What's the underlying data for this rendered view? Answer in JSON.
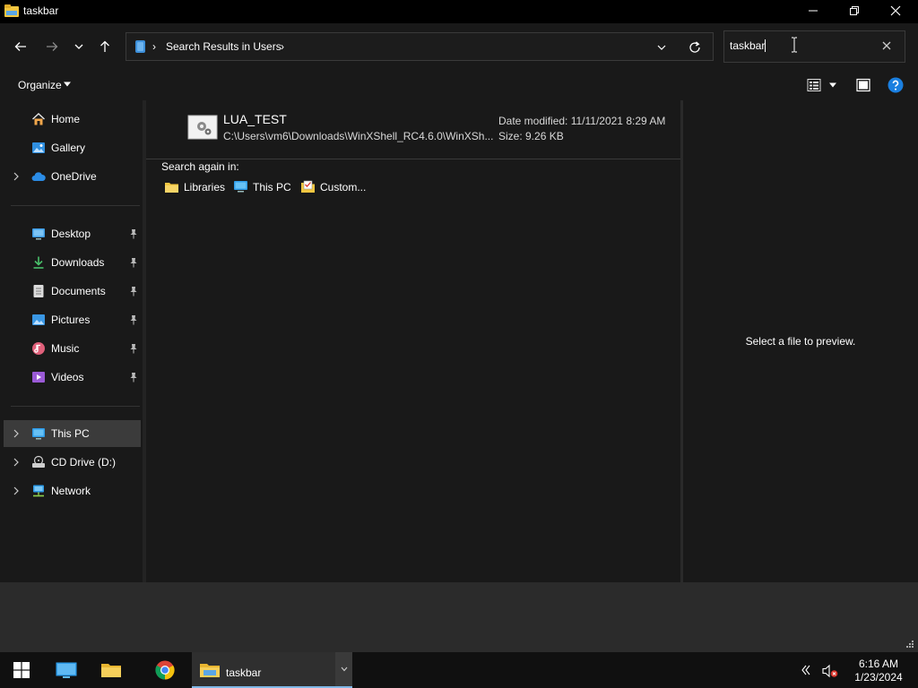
{
  "window": {
    "title": "taskbar"
  },
  "address": {
    "separator": "›",
    "path": "Search Results in Users",
    "trailing_separator": "›"
  },
  "search": {
    "value": "taskbar"
  },
  "commandbar": {
    "organize_label": "Organize"
  },
  "nav": {
    "quick": [
      {
        "label": "Home",
        "icon": "home-icon"
      },
      {
        "label": "Gallery",
        "icon": "gallery-icon"
      },
      {
        "label": "OneDrive",
        "icon": "onedrive-icon"
      }
    ],
    "pinned": [
      {
        "label": "Desktop",
        "icon": "desktop-icon"
      },
      {
        "label": "Downloads",
        "icon": "downloads-icon"
      },
      {
        "label": "Documents",
        "icon": "documents-icon"
      },
      {
        "label": "Pictures",
        "icon": "pictures-icon"
      },
      {
        "label": "Music",
        "icon": "music-icon"
      },
      {
        "label": "Videos",
        "icon": "videos-icon"
      }
    ],
    "devices": [
      {
        "label": "This PC",
        "icon": "this-pc-icon",
        "selected": true
      },
      {
        "label": "CD Drive (D:)",
        "icon": "cd-drive-icon"
      },
      {
        "label": "Network",
        "icon": "network-icon"
      }
    ]
  },
  "results": {
    "items": [
      {
        "name": "LUA_TEST",
        "path": "C:\\Users\\vm6\\Downloads\\WinXShell_RC4.6.0\\WinXSh...",
        "date_modified": "Date modified: 11/11/2021 8:29 AM",
        "size": "Size: 9.26 KB"
      }
    ],
    "search_again_label": "Search again in:",
    "search_again_items": [
      {
        "label": "Libraries",
        "icon": "libraries-folder-icon"
      },
      {
        "label": "This PC",
        "icon": "this-pc-icon"
      },
      {
        "label": "Custom...",
        "icon": "custom-folder-icon"
      }
    ]
  },
  "preview": {
    "empty_text": "Select a file to preview."
  },
  "taskbar": {
    "active_label": "taskbar",
    "time": "6:16 AM",
    "date": "1/23/2024"
  },
  "colors": {
    "window_bg": "#191919",
    "titlebar_bg": "#000000",
    "selected_bg": "#3b3b3b",
    "taskbar_bg": "#101010",
    "accent": "#7fb7e6",
    "folder_yellow": "#f2c641",
    "help_blue": "#1a7fe0"
  }
}
